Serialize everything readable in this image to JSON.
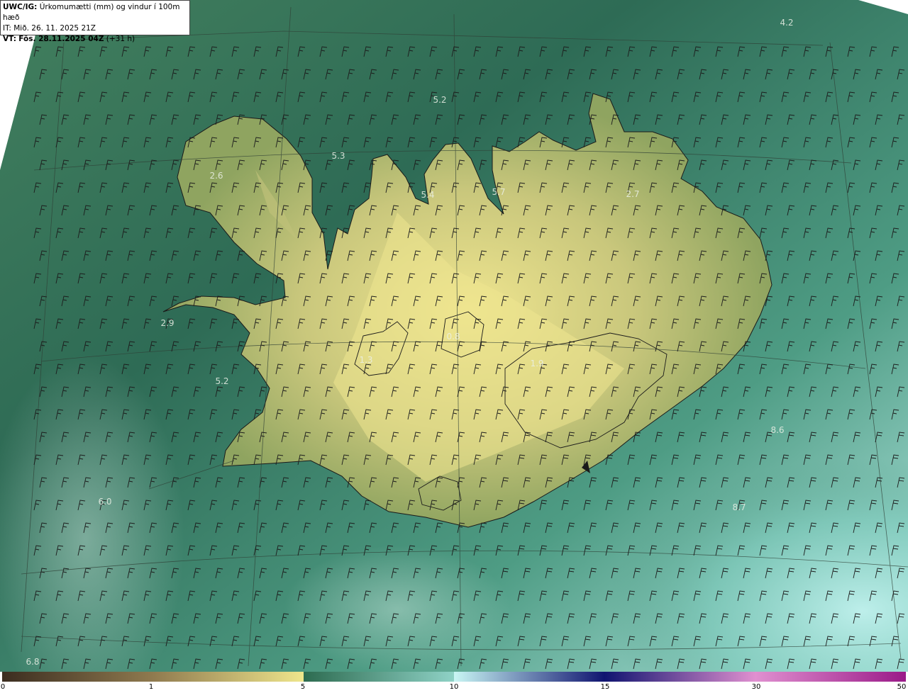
{
  "header": {
    "model": "UWC/IG:",
    "title": "Úrkomumætti (mm) og vindur í 100m hæð",
    "it_line": "IT: Mið. 26. 11. 2025 21Z",
    "vt_prefix": "VT:",
    "vt_time": "Fös. 28.11.2025 04Z",
    "vt_offset": "(+31 h)"
  },
  "map_labels": [
    {
      "text": "4.2",
      "at": "northeast ocean"
    },
    {
      "text": "5.2",
      "at": "north ocean"
    },
    {
      "text": "5.3",
      "at": "north of Vestfirðir"
    },
    {
      "text": "2.6",
      "at": "Vestfirðir"
    },
    {
      "text": "5.4",
      "at": "north Skagi"
    },
    {
      "text": "5.7",
      "at": "north Tröllaskagi"
    },
    {
      "text": "2.7",
      "at": "northeast highlands"
    },
    {
      "text": "2.9",
      "at": "Snæfellsnes"
    },
    {
      "text": "5.2",
      "at": "Faxaflói"
    },
    {
      "text": "0.8",
      "at": "Hofsjökull"
    },
    {
      "text": "1.9",
      "at": "Vatnajökull"
    },
    {
      "text": "1.3",
      "at": "Langjökull"
    },
    {
      "text": "6.0",
      "at": "southwest ocean"
    },
    {
      "text": "6.8",
      "at": "far southwest ocean"
    },
    {
      "text": "8.6",
      "at": "southeast ocean"
    },
    {
      "text": "8.7",
      "at": "south-southeast ocean"
    }
  ],
  "colors": {
    "ocean_west": "#2e6b55",
    "ocean_north": "#3f7f5e",
    "land_low": "#7f9a59",
    "land_dry": "#ebe591",
    "ocean_east": "#6bbfae",
    "ocean_southeast": "#aee4de",
    "barb": "#1c1c1c",
    "coast": "#1a1a1a",
    "grid": "#2f3f35"
  },
  "colorbar": {
    "ticks": [
      "0",
      "1",
      "5",
      "10",
      "15",
      "30",
      "50"
    ],
    "stops": [
      "#3b2d20",
      "#8f7a4f",
      "#efe68c",
      "#2d6b50",
      "#8fd2c6",
      "#c9f6f4",
      "#101470",
      "#e090d0",
      "#9a1a88"
    ]
  }
}
